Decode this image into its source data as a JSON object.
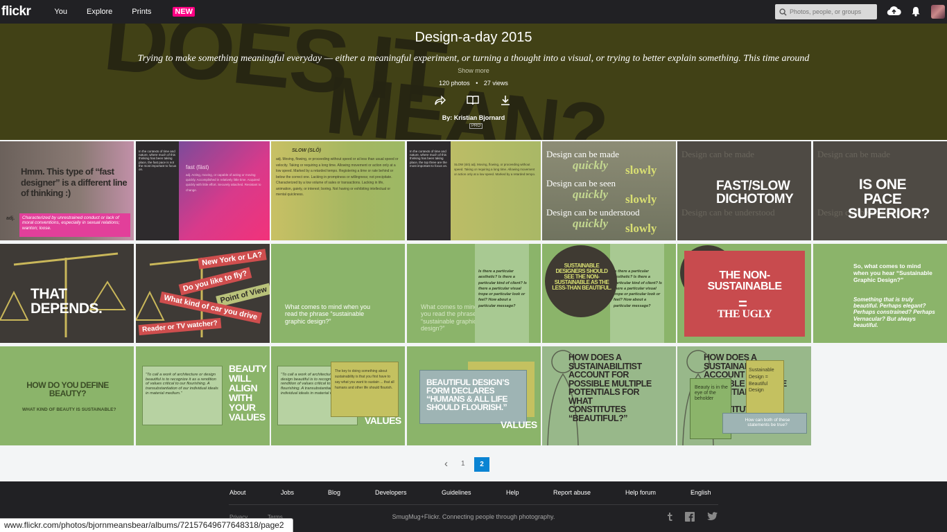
{
  "nav": {
    "logo": "flickr",
    "items": [
      "You",
      "Explore",
      "Prints"
    ],
    "new_badge": "NEW",
    "search_placeholder": "Photos, people, or groups"
  },
  "album": {
    "background_text_1": "DOES IT",
    "background_text_2": "MEAN?",
    "title": "Design-a-day 2015",
    "description": "Trying to make something meaningful everyday — either a meaningful experiment, or turning a thought into a visual, or trying to better explain something. This time around",
    "show_more": "Show more",
    "photos": "120 photos",
    "views": "27 views",
    "by": "By: Kristian Bjornard",
    "pro": "PRO"
  },
  "tiles": {
    "t1_heading": "Hmm. This type of “fast designer” is a different line of thinking :)",
    "t1_def": "Characterized by unrestrained conduct or lack of moral conventions, especially in sexual relations; wanton; loose.",
    "t1_adj": "adj.",
    "t2_word": "fast (fäst)",
    "t4_word": "SLOW (SLŌ)",
    "t5_l1": "Design can be made",
    "t5_l2": "Design can be seen",
    "t5_l3": "Design can be understood",
    "t5_q": "quickly",
    "t5_s": "slowly",
    "t6": "FAST/SLOW DICHOTOMY",
    "t7": "IS ONE PACE SUPERIOR?",
    "t8": "THAT DEPENDS.",
    "t9_tags": [
      "New York or LA?",
      "Do you like to fly?",
      "Point of View",
      "What kind of car you drive",
      "Reader or TV watcher?"
    ],
    "t10": "What comes to mind when you read the phrase “sustainable graphic design?”",
    "t11_qs": "Is there a particular aesthetic? Is there a particular kind of client? Is there a particular visual trope or particular look or feel? How about a particular message?",
    "t12_circle": "SUSTAINABLE DESIGNERS SHOULD SEE THE NON-SUSTAINABLE AS THE LESS-THAN BEAUTIFUL.",
    "t13_a": "THE NON-SUSTAINABLE",
    "t13_eq": "=",
    "t13_b": "THE UGLY",
    "t14_q": "So, what comes to mind when you hear “Sustainable Graphic Design?”",
    "t14_a": "Something that is truly beautiful. Perhaps elegant? Perhaps constrained? Perhaps Vernacular? But always beautiful.",
    "t15_q": "HOW DO YOU DEFINE BEAUTY?",
    "t15_sub": "WHAT KIND OF BEAUTY IS SUSTAINABLE?",
    "t16_quote": "“To call a work of architecture or design beautiful is to recognize it as a rendition of values critical to our flourishing. A transubstantiation of our individual ideals in material medium.”",
    "t16_big": "BEAUTY WILL ALIGN WITH YOUR VALUES",
    "t17_note": "The key to doing something about sustainability is that you first have to say what you want to sustain ... that all humans and other life should flourish.",
    "t17_big": "VALUES",
    "t18": "BEAUTIFUL DESIGN’S FORM DECLARES “HUMANS & ALL LIFE SHOULD FLOURISH.”",
    "t19": "HOW DOES A SUSTAINABILITIST ACCOUNT FOR POSSIBLE MULTIPLE POTENTIALS FOR WHAT CONSTITUTES “BEAUTIFUL?”",
    "t20_box": "Sustainable Design = Beautiful Design",
    "t20_left": "Beauty is in the eye of the beholder",
    "t20_q": "How can both of these statements be true?"
  },
  "pager": {
    "prev": "‹",
    "p1": "1",
    "p2": "2"
  },
  "footer": {
    "links": [
      "About",
      "Jobs",
      "Blog",
      "Developers",
      "Guidelines",
      "Help",
      "Report abuse",
      "Help forum",
      "English"
    ],
    "tagline": "SmugMug+Flickr. Connecting people through photography.",
    "privacy": "Privacy",
    "terms": "Terms"
  },
  "status_url": "www.flickr.com/photos/bjornmeansbear/albums/72157649677648318/page2",
  "colors": {
    "green": "#94b96b",
    "olive": "#b8bf5a",
    "dark": "#3d3a36",
    "pink": "#e23f9a",
    "red": "#cf4e4e",
    "accent": "#0a84d3"
  }
}
